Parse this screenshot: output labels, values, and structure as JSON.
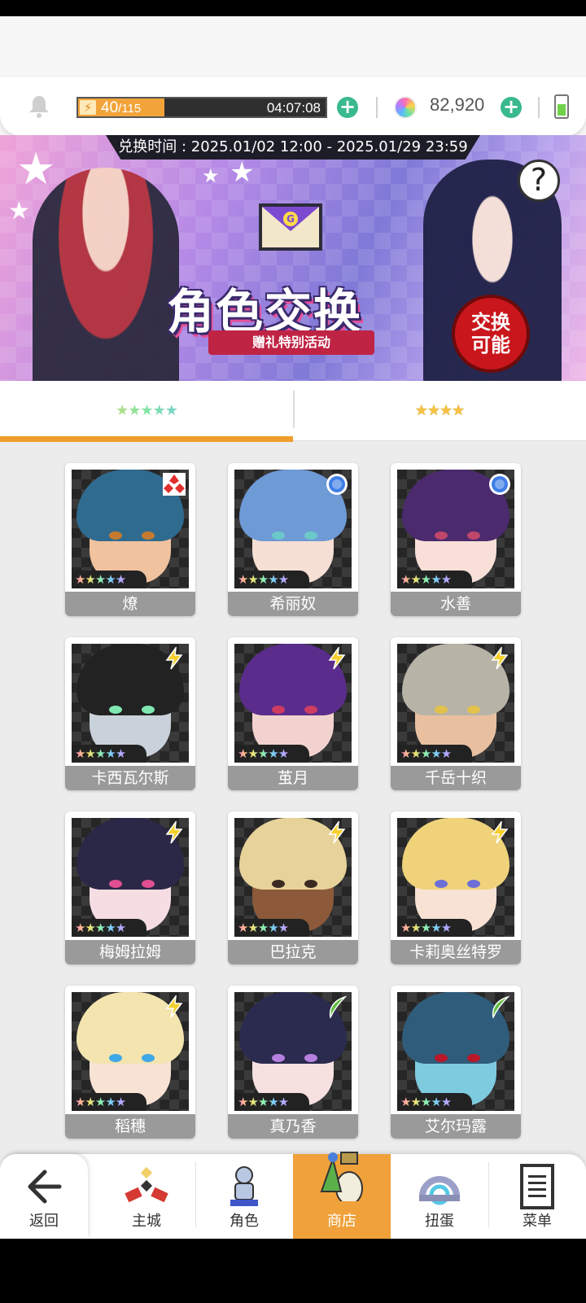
{
  "status": {
    "stamina_current": "40",
    "stamina_max": "/115",
    "stamina_fraction": 0.348,
    "stamina_timer": "04:07:08",
    "gems": "82,920",
    "colors": {
      "stamina": "#f2a43a",
      "plus": "#39b98f",
      "active_tab": "#ef9d2b"
    }
  },
  "banner": {
    "period": "兑换时间 : 2025.01/02 12:00 - 2025.01/29 23:59",
    "title": "角色交换",
    "subtitle": "赠礼特别活动",
    "badge_line1": "交换",
    "badge_line2": "可能",
    "help": "?",
    "envelope_letter": "G"
  },
  "tabs": [
    {
      "label": "★★★★★",
      "active": true
    },
    {
      "label": "★★★★",
      "active": false
    }
  ],
  "characters": [
    {
      "name": "燎",
      "rank": "★★★★★",
      "element": "fire-diamond-icon"
    },
    {
      "name": "希丽奴",
      "rank": "★★★★★",
      "element": "water-circle-icon"
    },
    {
      "name": "水善",
      "rank": "★★★★★",
      "element": "water-circle-icon"
    },
    {
      "name": "卡西瓦尔斯",
      "rank": "★★★★★",
      "element": "lightning-icon"
    },
    {
      "name": "茧月",
      "rank": "★★★★★",
      "element": "lightning-icon"
    },
    {
      "name": "千岳十织",
      "rank": "★★★★★",
      "element": "lightning-icon"
    },
    {
      "name": "梅姆拉姆",
      "rank": "★★★★★",
      "element": "lightning-icon"
    },
    {
      "name": "巴拉克",
      "rank": "★★★★★",
      "element": "lightning-icon"
    },
    {
      "name": "卡莉奥丝特罗",
      "rank": "★★★★★",
      "element": "lightning-icon"
    },
    {
      "name": "稻穗",
      "rank": "★★★★★",
      "element": "lightning-icon"
    },
    {
      "name": "真乃香",
      "rank": "★★★★★",
      "element": "wind-leaf-icon"
    },
    {
      "name": "艾尔玛露",
      "rank": "★★★★★",
      "element": "wind-leaf-icon"
    }
  ],
  "nav": [
    {
      "label": "返回",
      "icon": "back-arrow-icon"
    },
    {
      "label": "主城",
      "icon": "castle-icon"
    },
    {
      "label": "角色",
      "icon": "character-icon"
    },
    {
      "label": "商店",
      "icon": "shop-icon",
      "active": true
    },
    {
      "label": "扭蛋",
      "icon": "gacha-icon"
    },
    {
      "label": "菜单",
      "icon": "menu-list-icon"
    }
  ]
}
